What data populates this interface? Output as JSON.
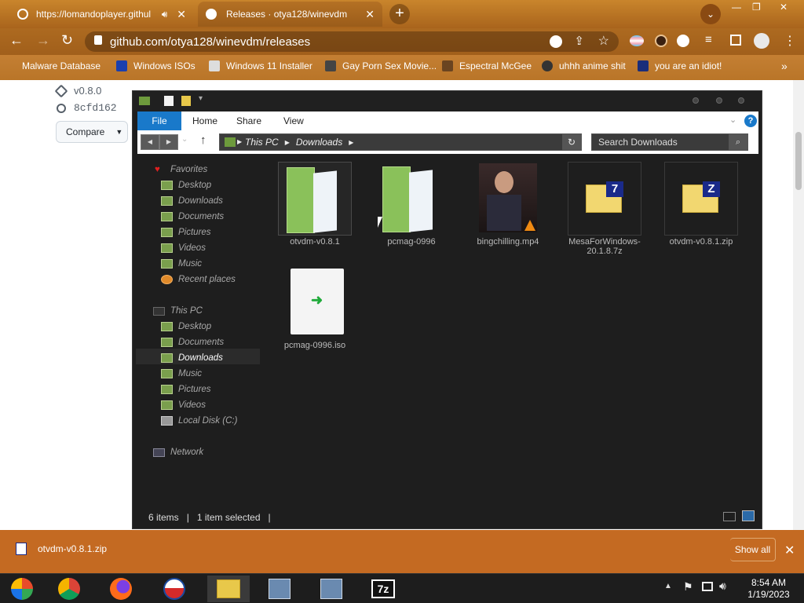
{
  "browser": {
    "tabs": [
      {
        "label": "https://lomandoplayer.githul",
        "active": false
      },
      {
        "label": "Releases · otya128/winevdm",
        "active": true
      }
    ],
    "url": "github.com/otya128/winevdm/releases",
    "bookmarks": [
      "Malware Database",
      "Windows ISOs",
      "Windows 11 Installer",
      "Gay Porn Sex Movie...",
      "Espectral McGee",
      "uhhh anime shit",
      "you are an idiot!"
    ]
  },
  "github": {
    "tag": "v0.8.0",
    "commit": "8cfd162",
    "compare_label": "Compare"
  },
  "explorer": {
    "ribbon_tabs": [
      "File",
      "Home",
      "Share",
      "View"
    ],
    "breadcrumb": [
      "This PC",
      "Downloads"
    ],
    "search_placeholder": "Search Downloads",
    "nav": {
      "favorites_label": "Favorites",
      "favorites": [
        "Desktop",
        "Downloads",
        "Documents",
        "Pictures",
        "Videos",
        "Music",
        "Recent places"
      ],
      "thispc_label": "This PC",
      "thispc": [
        "Desktop",
        "Documents",
        "Downloads",
        "Music",
        "Pictures",
        "Videos",
        "Local Disk (C:)"
      ],
      "network_label": "Network"
    },
    "files": [
      {
        "name": "otvdm-v0.8.1",
        "kind": "folder"
      },
      {
        "name": "pcmag-0996",
        "kind": "folder"
      },
      {
        "name": "bingchilling.mp4",
        "kind": "video"
      },
      {
        "name": "MesaForWindows-20.1.8.7z",
        "kind": "7z"
      },
      {
        "name": "otvdm-v0.8.1.zip",
        "kind": "zip"
      },
      {
        "name": "pcmag-0996.iso",
        "kind": "iso"
      }
    ],
    "status_items": "6 items",
    "status_selected": "1 item selected"
  },
  "download_bar": {
    "file": "otvdm-v0.8.1.zip",
    "show_all": "Show all"
  },
  "taskbar": {
    "time": "8:54 AM",
    "date": "1/19/2023"
  },
  "colors": {
    "accent_blue": "#1979ca",
    "chrome": "#b06b22",
    "explorer_bg": "#1e1e1e"
  }
}
